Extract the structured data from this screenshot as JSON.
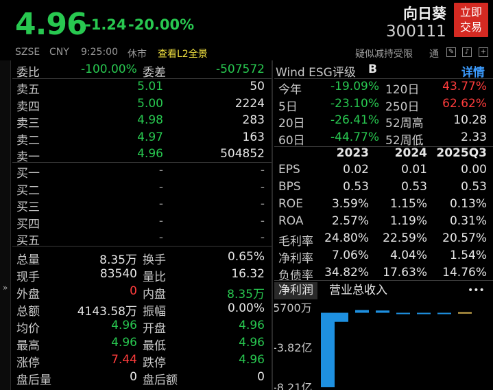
{
  "header": {
    "price": "4.96",
    "change": "-1.24",
    "change_pct": "-20.00%",
    "name": "向日葵",
    "code": "300111",
    "trade_btn": "立即\n交易",
    "trade_btn_l1": "立即",
    "trade_btn_l2": "交易"
  },
  "subbar": {
    "market": "SZSE",
    "currency": "CNY",
    "time": "9:25:00",
    "status": "休市",
    "l2_link": "查看L2全景",
    "notice": "疑似减持受限",
    "notice2": "通"
  },
  "orderbook": {
    "wei_bi_label": "委比",
    "wei_bi": "-100.00%",
    "wei_cha_label": "委差",
    "wei_cha": "-507572",
    "asks": [
      {
        "label": "卖五",
        "price": "5.01",
        "vol": "50"
      },
      {
        "label": "卖四",
        "price": "5.00",
        "vol": "2224"
      },
      {
        "label": "卖三",
        "price": "4.98",
        "vol": "283"
      },
      {
        "label": "卖二",
        "price": "4.97",
        "vol": "163"
      },
      {
        "label": "卖一",
        "price": "4.96",
        "vol": "504852"
      }
    ],
    "bids": [
      {
        "label": "买一",
        "price": "-",
        "vol": "-"
      },
      {
        "label": "买二",
        "price": "-",
        "vol": "-"
      },
      {
        "label": "买三",
        "price": "-",
        "vol": "-"
      },
      {
        "label": "买四",
        "price": "-",
        "vol": "-"
      },
      {
        "label": "买五",
        "price": "-",
        "vol": "-"
      }
    ]
  },
  "stats": [
    {
      "l1": "总量",
      "v1": "8.35万",
      "c1": "w",
      "l2": "换手",
      "v2": "0.65%",
      "c2": "w"
    },
    {
      "l1": "现手",
      "v1": "83540",
      "c1": "w",
      "l2": "量比",
      "v2": "16.32",
      "c2": "w"
    },
    {
      "l1": "外盘",
      "v1": "0",
      "c1": "r",
      "l2": "内盘",
      "v2": "8.35万",
      "c2": "g"
    },
    {
      "l1": "总额",
      "v1": "4143.58万",
      "c1": "w",
      "l2": "振幅",
      "v2": "0.00%",
      "c2": "w"
    },
    {
      "l1": "均价",
      "v1": "4.96",
      "c1": "g",
      "l2": "开盘",
      "v2": "4.96",
      "c2": "g"
    },
    {
      "l1": "最高",
      "v1": "4.96",
      "c1": "g",
      "l2": "最低",
      "v2": "4.96",
      "c2": "g"
    },
    {
      "l1": "涨停",
      "v1": "7.44",
      "c1": "r",
      "l2": "跌停",
      "v2": "4.96",
      "c2": "g"
    },
    {
      "l1": "盘后量",
      "v1": "0",
      "c1": "w",
      "l2": "盘后额",
      "v2": "0",
      "c2": "w"
    }
  ],
  "esg": {
    "label": "Wind ESG评级",
    "grade": "B",
    "detail": "详情"
  },
  "perf": [
    {
      "l1": "今年",
      "v1": "-19.09%",
      "c1": "g",
      "l2": "120日",
      "v2": "43.77%",
      "c2": "r"
    },
    {
      "l1": "5日",
      "v1": "-23.10%",
      "c1": "g",
      "l2": "250日",
      "v2": "62.62%",
      "c2": "r"
    },
    {
      "l1": "20日",
      "v1": "-26.41%",
      "c1": "g",
      "l2": "52周高",
      "v2": "10.28",
      "c2": "w"
    },
    {
      "l1": "60日",
      "v1": "-44.77%",
      "c1": "g",
      "l2": "52周低",
      "v2": "2.33",
      "c2": "w"
    }
  ],
  "fin": {
    "years": [
      "2023",
      "2024",
      "2025Q3"
    ],
    "rows": [
      {
        "label": "EPS",
        "vals": [
          "0.02",
          "0.01",
          "0.00"
        ]
      },
      {
        "label": "BPS",
        "vals": [
          "0.53",
          "0.53",
          "0.53"
        ]
      },
      {
        "label": "ROE",
        "vals": [
          "3.59%",
          "1.15%",
          "0.13%"
        ]
      },
      {
        "label": "ROA",
        "vals": [
          "2.57%",
          "1.19%",
          "0.31%"
        ]
      },
      {
        "label": "毛利率",
        "vals": [
          "24.80%",
          "22.59%",
          "20.57%"
        ]
      },
      {
        "label": "净利率",
        "vals": [
          "7.06%",
          "4.04%",
          "1.54%"
        ]
      },
      {
        "label": "负债率",
        "vals": [
          "34.82%",
          "17.63%",
          "14.76%"
        ]
      }
    ]
  },
  "tabs": {
    "net_profit": "净利润",
    "revenue": "营业总收入",
    "more": "•••"
  },
  "chart_data": {
    "type": "bar",
    "ytick_labels": [
      "5700万",
      "-3.82亿",
      "-8.21亿"
    ],
    "ytick_values": [
      57000000,
      -382000000,
      -821000000
    ],
    "values": [
      -821000000,
      -100000000,
      30000000,
      25000000,
      -8000000,
      -12000000,
      -5000000,
      6000000
    ],
    "colors": {
      "neg": "#1e90e0",
      "pos": "#1e90e0",
      "last": "#d4b050"
    }
  },
  "icons": [
    "edit-icon",
    "bell-icon",
    "home-icon",
    "add-icon"
  ]
}
